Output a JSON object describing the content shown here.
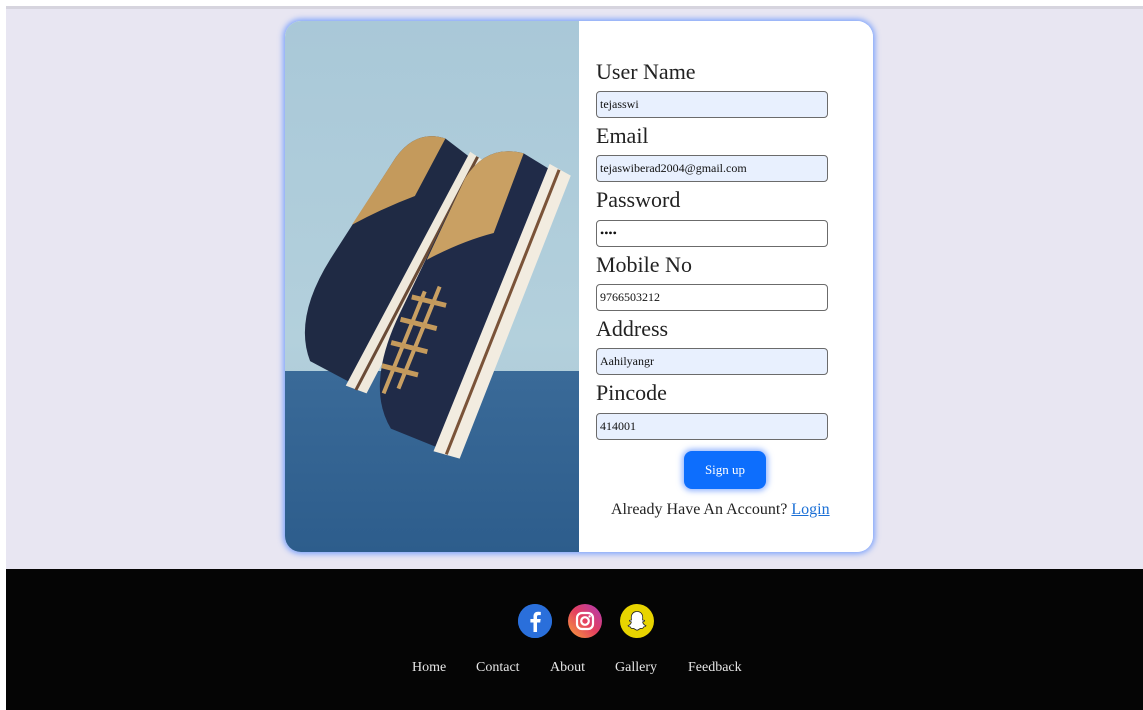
{
  "form": {
    "fields": [
      {
        "label": "User Name",
        "value": "tejasswi"
      },
      {
        "label": "Email",
        "value": "tejaswiberad2004@gmail.com"
      },
      {
        "label": "Password",
        "value": "••••"
      },
      {
        "label": "Mobile No",
        "value": "9766503212"
      },
      {
        "label": "Address",
        "value": "Aahilyangr"
      },
      {
        "label": "Pincode",
        "value": "414001"
      }
    ],
    "signup_label": "Sign up",
    "login_prompt": "Already Have An Account?",
    "login_link": "Login"
  },
  "footer": {
    "social_icons": [
      "facebook-icon",
      "instagram-icon",
      "snapchat-icon"
    ],
    "links": [
      "Home",
      "Contact",
      "About",
      "Gallery",
      "Feedback"
    ]
  },
  "colors": {
    "accent": "#0d6efd",
    "page_bg": "#e8e6f2",
    "footer_bg": "#050505",
    "link": "#1a6fd6"
  }
}
